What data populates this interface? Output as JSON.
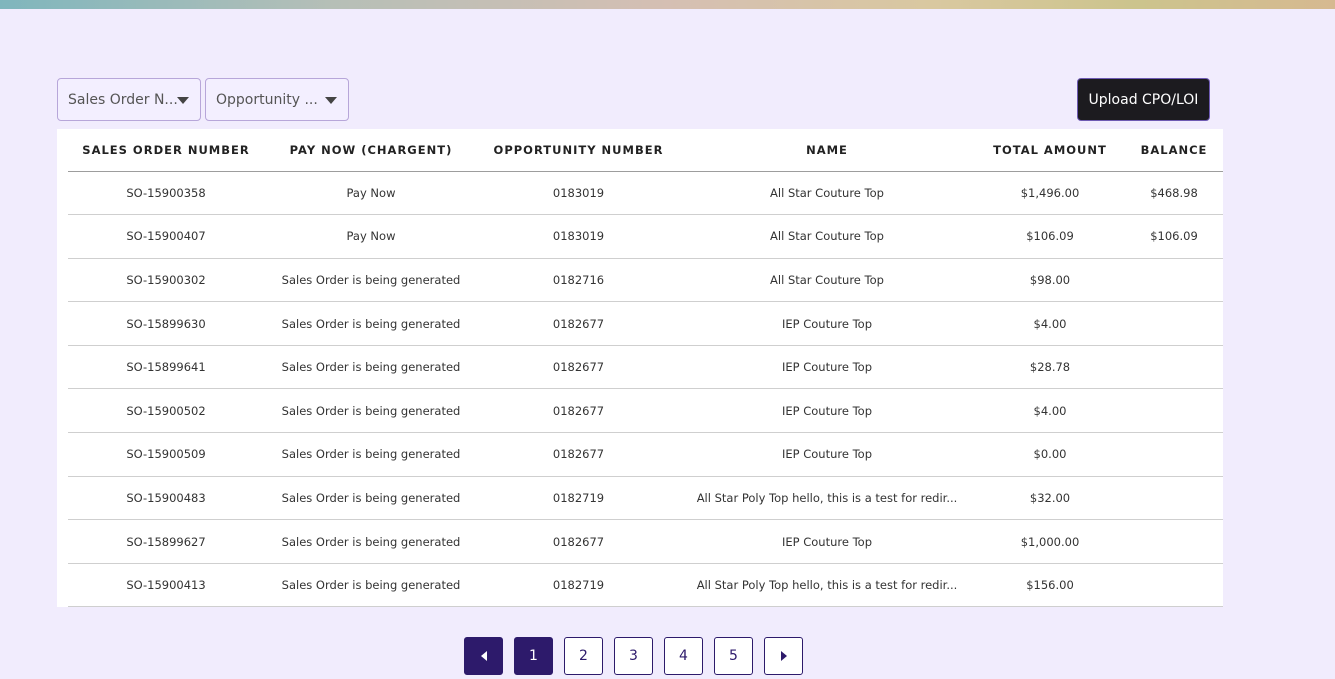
{
  "filters": [
    {
      "label": "Sales Order N..."
    },
    {
      "label": "Opportunity ..."
    }
  ],
  "upload_label": "Upload CPO/LOI",
  "table": {
    "headers": [
      "SALES ORDER NUMBER",
      "PAY NOW (CHARGENT)",
      "OPPORTUNITY NUMBER",
      "NAME",
      "TOTAL AMOUNT",
      "BALANCE"
    ],
    "rows": [
      [
        "SO-15900358",
        "Pay Now",
        "0183019",
        "All Star Couture Top",
        "$1,496.00",
        "$468.98"
      ],
      [
        "SO-15900407",
        "Pay Now",
        "0183019",
        "All Star Couture Top",
        "$106.09",
        "$106.09"
      ],
      [
        "SO-15900302",
        "Sales Order is being generated",
        "0182716",
        "All Star Couture Top",
        "$98.00",
        ""
      ],
      [
        "SO-15899630",
        "Sales Order is being generated",
        "0182677",
        "IEP Couture Top",
        "$4.00",
        ""
      ],
      [
        "SO-15899641",
        "Sales Order is being generated",
        "0182677",
        "IEP Couture Top",
        "$28.78",
        ""
      ],
      [
        "SO-15900502",
        "Sales Order is being generated",
        "0182677",
        "IEP Couture Top",
        "$4.00",
        ""
      ],
      [
        "SO-15900509",
        "Sales Order is being generated",
        "0182677",
        "IEP Couture Top",
        "$0.00",
        ""
      ],
      [
        "SO-15900483",
        "Sales Order is being generated",
        "0182719",
        "All Star Poly Top hello, this is a test for redir...",
        "$32.00",
        ""
      ],
      [
        "SO-15899627",
        "Sales Order is being generated",
        "0182677",
        "IEP Couture Top",
        "$1,000.00",
        ""
      ],
      [
        "SO-15900413",
        "Sales Order is being generated",
        "0182719",
        "All Star Poly Top hello, this is a test for redir...",
        "$156.00",
        ""
      ]
    ]
  },
  "pagination": {
    "pages": [
      "1",
      "2",
      "3",
      "4",
      "5"
    ],
    "current": "1",
    "prev_icon": "caret-left-icon",
    "next_icon": "caret-right-icon"
  },
  "colors": {
    "background": "#f1ecfd",
    "primary": "#2d1a6b",
    "button_dark": "#1c1b1f"
  }
}
